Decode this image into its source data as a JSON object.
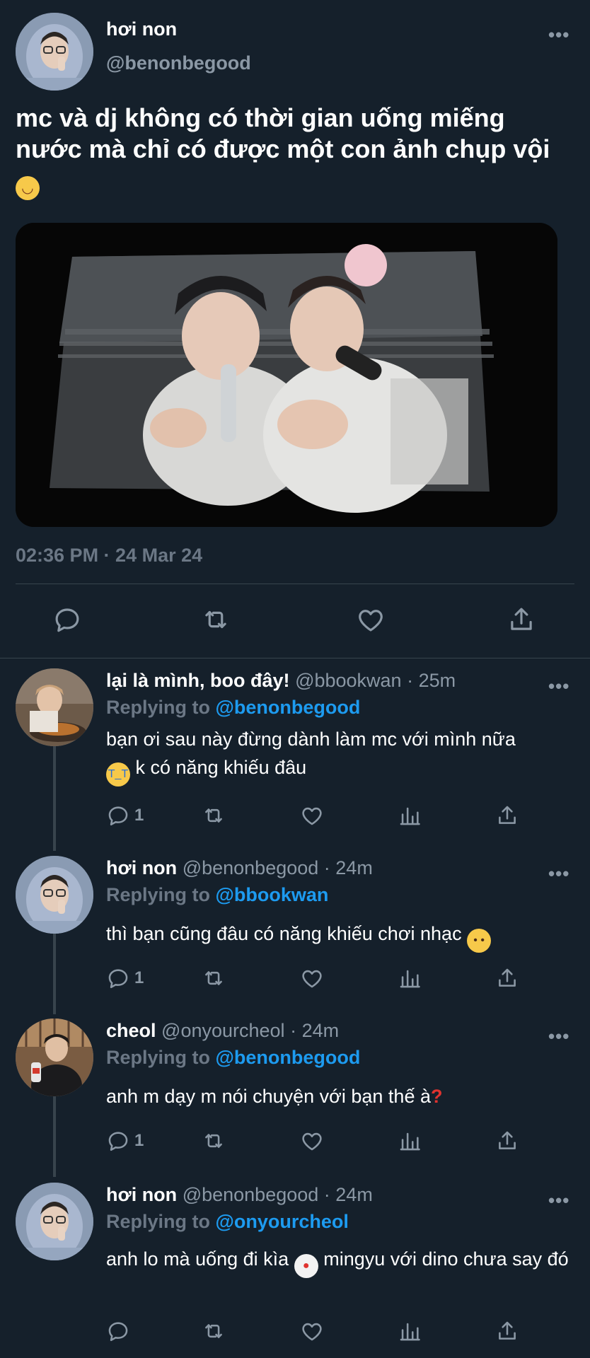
{
  "main_tweet": {
    "author_name": "hơi non",
    "author_handle": "@benonbegood",
    "text": "mc và dj không có thời gian uống miếng nước mà chỉ có được một con ảnh chụp vội",
    "text_emoji": "😋",
    "timestamp": "02:36 PM · 24 Mar 24",
    "more_label": "•••",
    "actions": [
      "reply-icon",
      "retweet-icon",
      "like-icon",
      "share-icon"
    ]
  },
  "replies": [
    {
      "author_name": "lại là mình, boo đây!",
      "author_handle": "@bbookwan",
      "time": "· 25m",
      "replying_label": "Replying to",
      "replying_to": "@benonbegood",
      "text": "bạn ơi sau này đừng dành làm mc với mình nữa",
      "text_emoji": "😭",
      "text_after": " k có năng khiếu đâu",
      "reply_count": "1",
      "more_label": "•••"
    },
    {
      "author_name": "hơi non",
      "author_handle": "@benonbegood",
      "time": "· 24m",
      "replying_label": "Replying to",
      "replying_to": "@bbookwan",
      "text": "thì bạn cũng đâu có năng khiếu chơi nhạc",
      "text_emoji": "🥺",
      "reply_count": "1",
      "more_label": "•••"
    },
    {
      "author_name": "cheol",
      "author_handle": "@onyourcheol",
      "time": "· 24m",
      "replying_label": "Replying to",
      "replying_to": "@benonbegood",
      "text": "anh m dạy m nói chuyện với bạn thế à",
      "text_emoji": "❓",
      "reply_count": "1",
      "more_label": "•••"
    },
    {
      "author_name": "hơi non",
      "author_handle": "@benonbegood",
      "time": "· 24m",
      "replying_label": "Replying to",
      "replying_to": "@onyourcheol",
      "text": "anh lo mà uống đi kìa",
      "text_emoji": "🤡",
      "text_after": " mingyu với dino chưa say đó",
      "reply_count": "",
      "more_label": "•••"
    }
  ],
  "colors": {
    "background": "#15202b",
    "secondary_text": "#8b98a5",
    "mention": "#1d9bf0",
    "divider": "#38444d"
  }
}
